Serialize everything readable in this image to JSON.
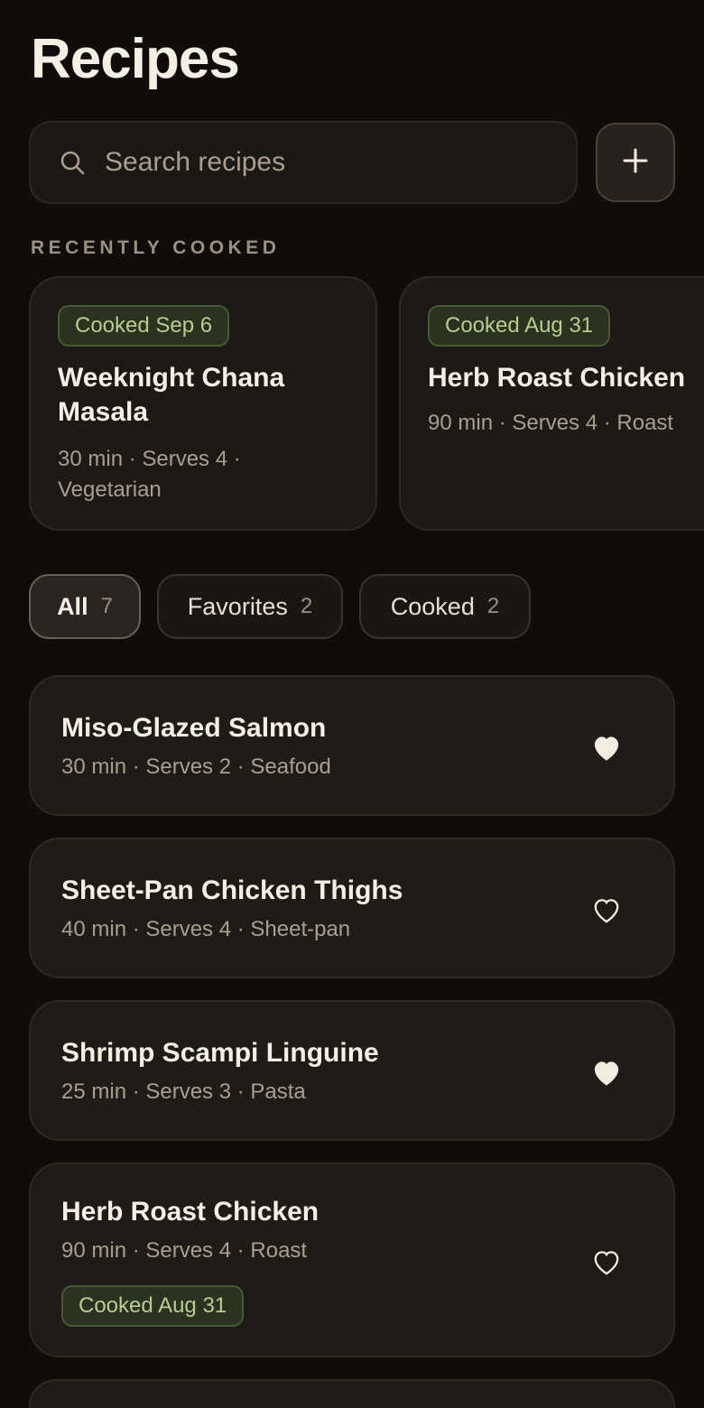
{
  "header": {
    "title": "Recipes"
  },
  "search": {
    "placeholder": "Search recipes"
  },
  "recently_cooked": {
    "label": "RECENTLY COOKED",
    "cards": [
      {
        "badge": "Cooked Sep 6",
        "title": "Weeknight Chana Masala",
        "meta": "30 min · Serves 4 · Vegetarian"
      },
      {
        "badge": "Cooked Aug 31",
        "title": "Herb Roast Chicken",
        "meta": "90 min · Serves 4 · Roast"
      }
    ]
  },
  "filters": [
    {
      "label": "All",
      "count": "7",
      "active": true
    },
    {
      "label": "Favorites",
      "count": "2",
      "active": false
    },
    {
      "label": "Cooked",
      "count": "2",
      "active": false
    }
  ],
  "recipes": [
    {
      "name": "Miso-Glazed Salmon",
      "meta": "30 min · Serves 2 · Seafood",
      "favorite": true
    },
    {
      "name": "Sheet-Pan Chicken Thighs",
      "meta": "40 min · Serves 4 · Sheet-pan",
      "favorite": false
    },
    {
      "name": "Shrimp Scampi Linguine",
      "meta": "25 min · Serves 3 · Pasta",
      "favorite": true
    },
    {
      "name": "Herb Roast Chicken",
      "meta": "90 min · Serves 4 · Roast",
      "favorite": false,
      "badge": "Cooked Aug 31"
    }
  ],
  "colors": {
    "background": "#0f0c0a",
    "card": "#1f1b17",
    "badge_text": "#b8cc91",
    "badge_bg": "#2b3320",
    "heart": "#f3ece2"
  },
  "icons": {
    "search": "search-icon",
    "add": "plus-icon",
    "favorite_filled": "heart-filled-icon",
    "favorite_outline": "heart-outline-icon"
  }
}
